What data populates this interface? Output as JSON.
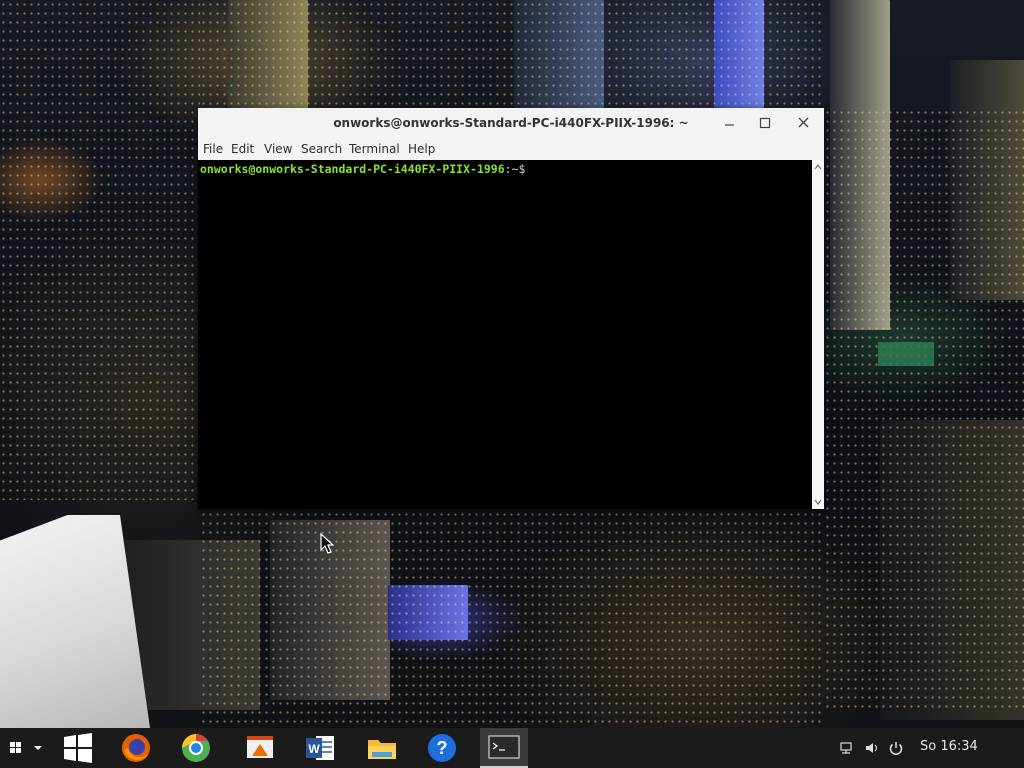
{
  "window": {
    "title": "onworks@onworks-Standard-PC-i440FX-PIIX-1996: ~",
    "menu": [
      "File",
      "Edit",
      "View",
      "Search",
      "Terminal",
      "Help"
    ]
  },
  "terminal": {
    "prompt_user": "onworks@onworks-Standard-PC-i440FX-PIIX-1996",
    "prompt_rest": ":~$ "
  },
  "taskbar": {
    "apps": [
      "start-menu",
      "show-desktop",
      "firefox",
      "chrome-like",
      "presentation",
      "word",
      "files",
      "help",
      "terminal"
    ],
    "clock": "So 16:34"
  },
  "colors": {
    "prompt_green": "#8ae234",
    "terminal_bg": "#000000",
    "taskbar_bg": "#1b1b1b"
  }
}
